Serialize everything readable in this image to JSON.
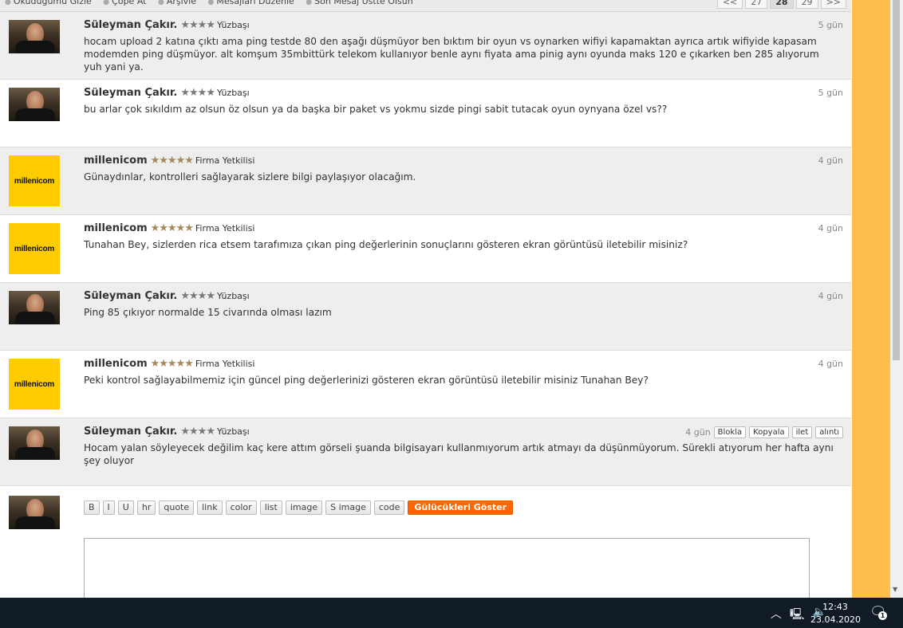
{
  "topbar": {
    "actions": [
      "Okuduğumu Gizle",
      "Çöpe At",
      "Arşivle",
      "Mesajları Düzenle",
      "Son Mesaj Üstte Olsun"
    ],
    "pager": [
      "<<",
      "27",
      "28",
      "29",
      ">>"
    ],
    "current_page": "28"
  },
  "posts": [
    {
      "author": "Süleyman Çakır.",
      "stars": "★★★★",
      "rank": "Yüzbaşı",
      "time": "5 gün",
      "avatar": "person-photo",
      "text": "hocam upload 2 katına çıktı ama ping testde 80 den aşağı düşmüyor ben bıktım bir oyun vs oynarken wifiyi kapamaktan ayrıca artık wifiyide kapasam modemden ping düşmüyor. alt komşum 35mbittürk telekom kullanıyor benle aynı fiyata ama pinig aynı oyunda maks 120 e çıkarken ben 285 alıyorum yuh yani ya."
    },
    {
      "author": "Süleyman Çakır.",
      "stars": "★★★★",
      "rank": "Yüzbaşı",
      "time": "5 gün",
      "avatar": "person-photo",
      "text": "bu arlar çok sıkıldım az olsun öz olsun ya da başka bir paket vs yokmu sizde pingi sabit tutacak oyun oynyana özel vs??"
    },
    {
      "author": "millenicom",
      "stars": "★★★★★",
      "rank": "Firma Yetkilisi",
      "time": "4 gün",
      "avatar": "millenicom",
      "text": "Günaydınlar, kontrolleri sağlayarak sizlere bilgi paylaşıyor olacağım."
    },
    {
      "author": "millenicom",
      "stars": "★★★★★",
      "rank": "Firma Yetkilisi",
      "time": "4 gün",
      "avatar": "millenicom",
      "text": "Tunahan Bey, sizlerden rica etsem tarafımıza çıkan ping değerlerinin sonuçlarını gösteren ekran görüntüsü iletebilir misiniz?"
    },
    {
      "author": "Süleyman Çakır.",
      "stars": "★★★★",
      "rank": "Yüzbaşı",
      "time": "4 gün",
      "avatar": "person-photo",
      "text": "Ping 85 çıkıyor normalde 15 civarında olması lazım"
    },
    {
      "author": "millenicom",
      "stars": "★★★★★",
      "rank": "Firma Yetkilisi",
      "time": "4 gün",
      "avatar": "millenicom",
      "text": "Peki kontrol sağlayabilmemiz için güncel ping değerlerinizi gösteren ekran görüntüsü iletebilir misiniz Tunahan Bey?"
    },
    {
      "author": "Süleyman Çakır.",
      "stars": "★★★★",
      "rank": "Yüzbaşı",
      "time": "4 gün",
      "avatar": "person-photo",
      "text": "Hocam yalan söyleyecek değilim kaç kere attım görseli şuanda bilgisayarı kullanmıyorum artık atmayı da düşünmüyorum. Sürekli atıyorum her hafta aynı şey oluyor",
      "buttons": [
        "Blokla",
        "Kopyala",
        "ilet",
        "alıntı"
      ]
    }
  ],
  "brand_logo_text": "millenicom",
  "editor": {
    "buttons": [
      "B",
      "I",
      "U",
      "hr",
      "quote",
      "link",
      "color",
      "list",
      "image",
      "S image",
      "code"
    ],
    "smiley_button": "Gülücükleri Göster"
  },
  "taskbar": {
    "time": "12:43",
    "date": "23.04.2020",
    "notification_count": "1"
  },
  "colors": {
    "accent_orange": "#ff6600",
    "side_panel": "#ffbf4d",
    "brand_yellow": "#ffcc00"
  }
}
